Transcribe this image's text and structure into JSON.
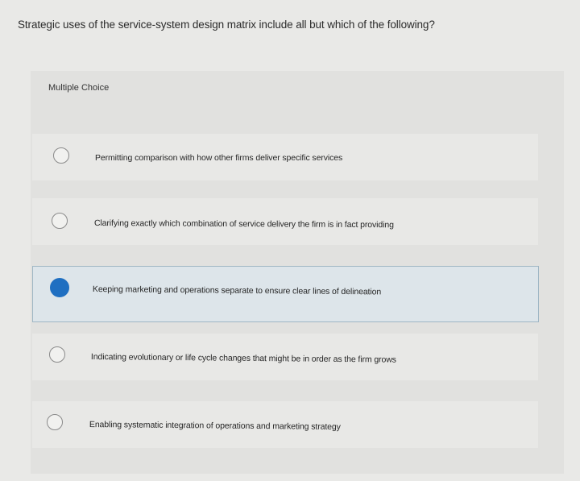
{
  "question": {
    "text": "Strategic uses of the service-system design matrix include all but which of the following?",
    "type_label": "Multiple Choice"
  },
  "options": [
    {
      "text": "Permitting comparison with how other firms deliver specific services",
      "selected": false
    },
    {
      "text": "Clarifying exactly which combination of service delivery the firm is in fact providing",
      "selected": false
    },
    {
      "text": "Keeping marketing and operations separate to ensure clear lines of delineation",
      "selected": true
    },
    {
      "text": "Indicating evolutionary or life cycle changes that might be in order as the firm grows",
      "selected": false
    },
    {
      "text": "Enabling systematic integration of operations and marketing strategy",
      "selected": false
    }
  ],
  "colors": {
    "selected_radio": "#1f6fc1",
    "selected_row_bg": "#dde5ea",
    "page_bg": "#e9e9e7"
  }
}
